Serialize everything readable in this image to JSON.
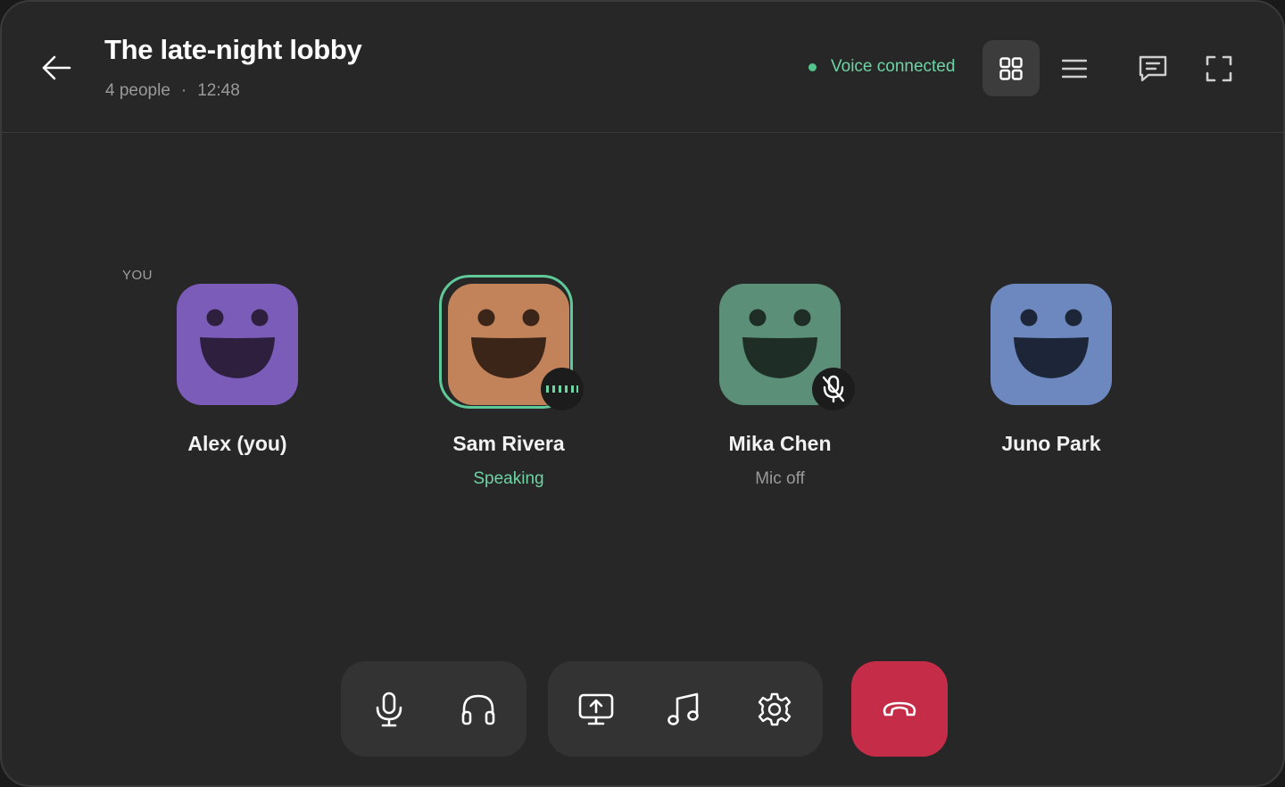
{
  "room": {
    "title": "The late-night lobby",
    "people_count": "4 people",
    "separator": "·",
    "elapsed": "12:48"
  },
  "voice": {
    "status": "Voice connected",
    "color": "#52c48c"
  },
  "header_actions": {
    "back_icon": "arrow-left-icon",
    "grid_view_icon": "grid-view-icon",
    "list_view_icon": "list-view-icon",
    "chat_icon": "chat-icon",
    "fullscreen_icon": "fullscreen-icon",
    "active_view": "grid"
  },
  "participants": [
    {
      "name": "Alex (you)",
      "tag": "YOU",
      "status": "",
      "avatar_color": "#7b5cb8",
      "mouth_color": "#2e1f3f",
      "speaking": false,
      "muted": false
    },
    {
      "name": "Sam Rivera",
      "tag": "",
      "status": "Speaking",
      "avatar_color": "#c2825a",
      "mouth_color": "#3b2418",
      "speaking": true,
      "muted": false
    },
    {
      "name": "Mika Chen",
      "tag": "",
      "status": "Mic off",
      "avatar_color": "#5b8f78",
      "mouth_color": "#1e2d26",
      "speaking": false,
      "muted": true
    },
    {
      "name": "Juno Park",
      "tag": "",
      "status": "",
      "avatar_color": "#6d88bf",
      "mouth_color": "#1c2638",
      "speaking": false,
      "muted": false
    }
  ],
  "controls": {
    "mic_icon": "microphone-icon",
    "headphones_icon": "headphones-icon",
    "share_screen_icon": "share-screen-icon",
    "music_icon": "music-note-icon",
    "settings_icon": "gear-icon",
    "leave_icon": "hang-up-icon",
    "leave_color": "#c42c48"
  }
}
